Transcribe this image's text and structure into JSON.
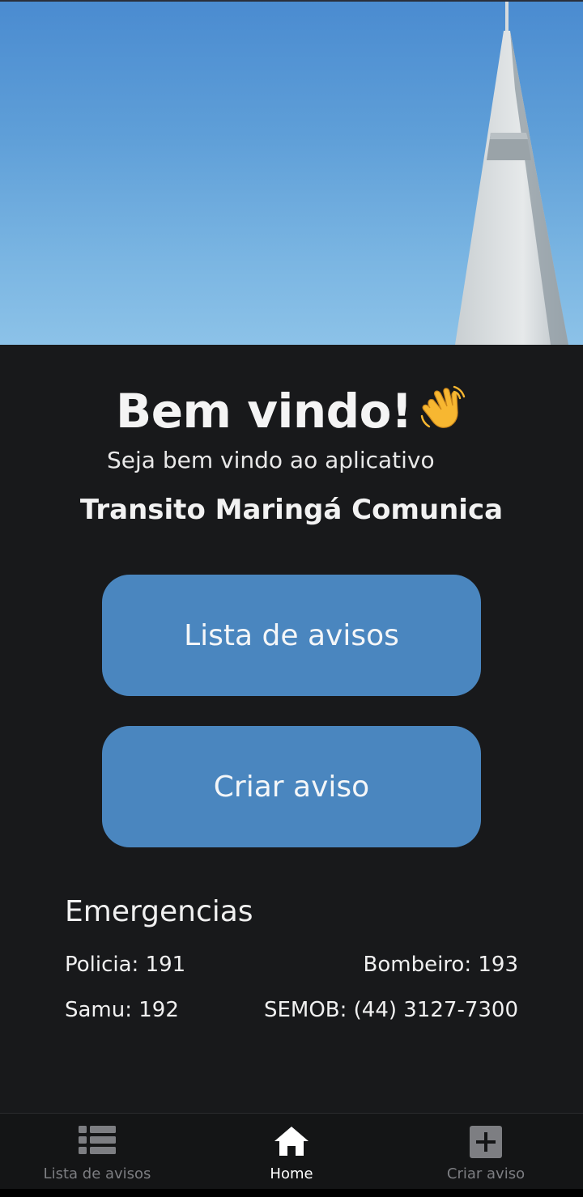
{
  "header": {
    "title": "Bem vindo!",
    "wave_icon": "waving-hand-icon",
    "subtitle": "Seja bem vindo ao aplicativo",
    "app_name": "Transito Maringá Comunica"
  },
  "actions": {
    "list_label": "Lista de avisos",
    "create_label": "Criar aviso"
  },
  "emergencies": {
    "title": "Emergencias",
    "police": "Policia: 191",
    "firefighter": "Bombeiro: 193",
    "samu": "Samu: 192",
    "semob": "SEMOB: (44) 3127-7300"
  },
  "nav": {
    "items": [
      {
        "label": "Lista de avisos",
        "icon": "list-icon",
        "active": false
      },
      {
        "label": "Home",
        "icon": "home-icon",
        "active": true
      },
      {
        "label": "Criar aviso",
        "icon": "add-box-icon",
        "active": false
      }
    ]
  },
  "colors": {
    "background": "#18191b",
    "button": "#4a86bf",
    "nav_background": "#141516",
    "nav_inactive": "#7d7e82",
    "nav_active": "#ffffff"
  }
}
